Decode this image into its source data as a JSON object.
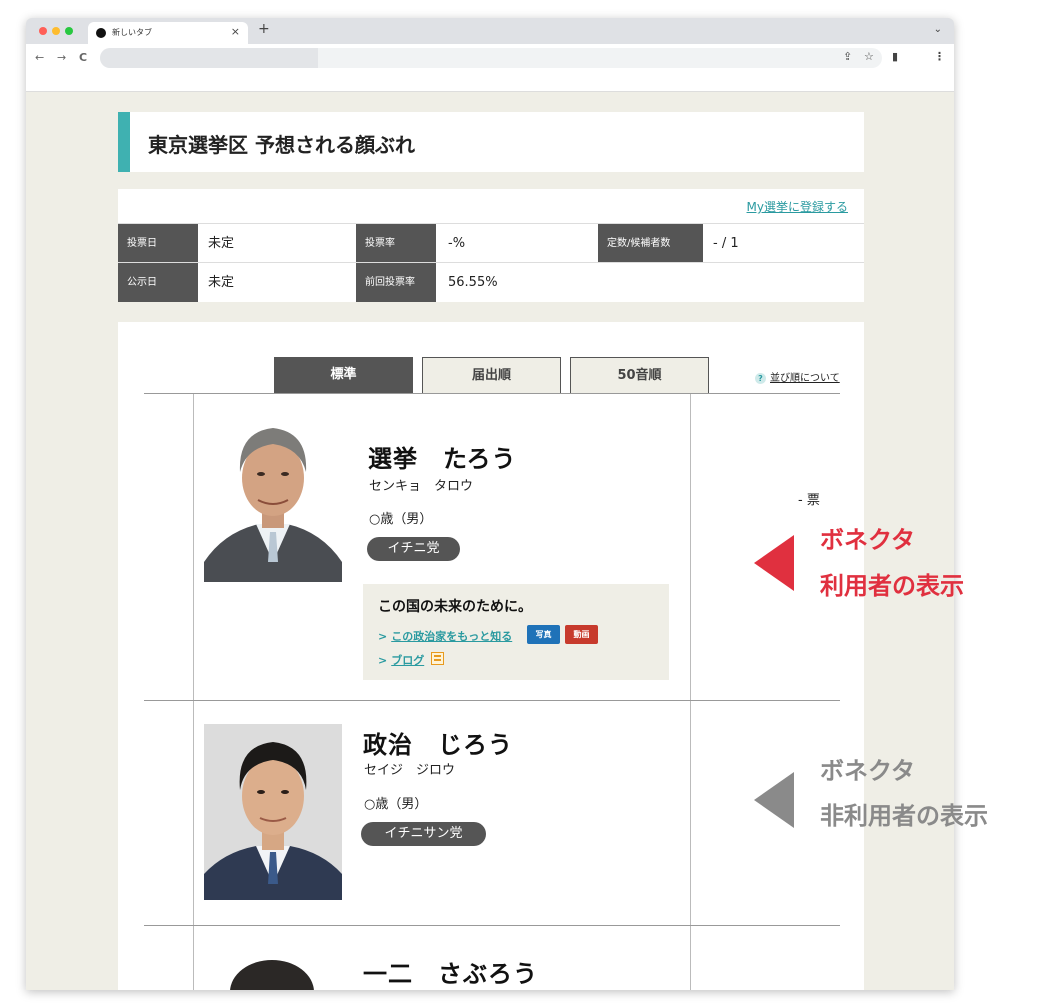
{
  "browser": {
    "tab_title": "新しいタブ",
    "tab_close": "×",
    "new_tab": "+",
    "tab_menu": "⌄",
    "back": "←",
    "forward": "→",
    "reload": "C",
    "share": "⇪",
    "star": "☆",
    "sidebar": "▮",
    "menu": "⋮"
  },
  "page": {
    "title": "東京選挙区 予想される顔ぶれ",
    "myelection_link": "My選挙に登録する",
    "info": {
      "vote_day_label": "投票日",
      "vote_day_value": "未定",
      "turnout_label": "投票率",
      "turnout_value": "-%",
      "seats_label": "定数/候補者数",
      "seats_value": "- / 1",
      "announce_label": "公示日",
      "announce_value": "未定",
      "prev_turnout_label": "前回投票率",
      "prev_turnout_value": "56.55%"
    },
    "sort_tabs": [
      "標準",
      "届出順",
      "50音順"
    ],
    "help_text": "並び順について",
    "help_icon": "?",
    "candidates": [
      {
        "name": "選挙　たろう",
        "kana": "センキョ　タロウ",
        "age": "○歳（男）",
        "party": "イチニ党",
        "votes": "- 票",
        "slogan": "この国の未来のために。",
        "link_more": "この政治家をもっと知る",
        "badge_photo": "写真",
        "badge_video": "動画",
        "link_blog": "ブログ"
      },
      {
        "name": "政治　じろう",
        "kana": "セイジ　ジロウ",
        "age": "○歳（男）",
        "party": "イチニサン党"
      },
      {
        "name": "一二　さぶろう"
      }
    ]
  },
  "annotations": {
    "user_line1": "ボネクタ",
    "user_line2": "利用者の表示",
    "nonuser_line1": "ボネクタ",
    "nonuser_line2": "非利用者の表示"
  },
  "colors": {
    "accent_teal": "#3fb1b1",
    "annotation_red": "#e0303f",
    "annotation_gray": "#8a8a8a",
    "label_dark": "#555555"
  }
}
